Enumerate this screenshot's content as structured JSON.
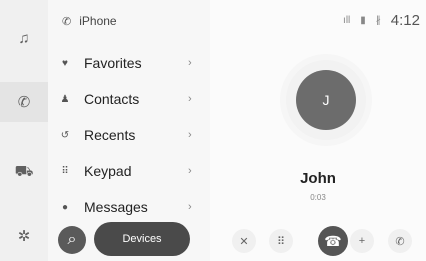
{
  "sidebar": {
    "buttons": [
      {
        "name": "music-icon",
        "glyph": "♫"
      },
      {
        "name": "phone-icon",
        "glyph": "✆"
      },
      {
        "name": "car-icon",
        "glyph": "⛟"
      },
      {
        "name": "gear-icon",
        "glyph": "✲"
      }
    ]
  },
  "phone_list": {
    "header": {
      "icon": "phone-icon",
      "glyph": "✆",
      "label": "iPhone"
    },
    "items": [
      {
        "icon": "heart-icon",
        "glyph": "♥",
        "label": "Favorites",
        "chevron": "›"
      },
      {
        "icon": "person-icon",
        "glyph": "♟",
        "label": "Contacts",
        "chevron": "›"
      },
      {
        "icon": "history-icon",
        "glyph": "↺",
        "label": "Recents",
        "chevron": "›"
      },
      {
        "icon": "keypad-icon",
        "glyph": "⠿",
        "label": "Keypad",
        "chevron": "›"
      },
      {
        "icon": "message-icon",
        "glyph": "●",
        "label": "Messages",
        "chevron": "›"
      }
    ],
    "search_glyph": "⌕",
    "devices_label": "Devices"
  },
  "status_bar": {
    "signal_glyph": "ıll",
    "battery_glyph": "▮",
    "bluetooth_glyph": "∦",
    "time": "4:12"
  },
  "call": {
    "avatar_initial": "J",
    "caller_name": "John",
    "duration": "0:03",
    "controls": {
      "mute_glyph": "✕",
      "keypad_glyph": "⠿",
      "hangup_glyph": "☎",
      "add_glyph": "+",
      "switch_glyph": "✆"
    }
  },
  "colors": {
    "accent": "#4a4a4a",
    "hangup": "#555555",
    "background": "#fbfbfb"
  }
}
